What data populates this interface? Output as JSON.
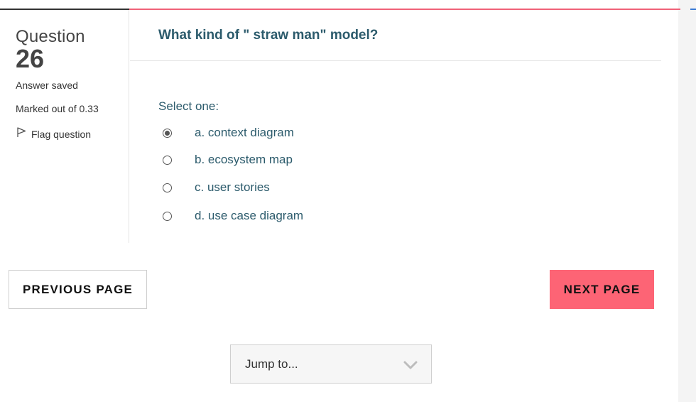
{
  "info": {
    "question_word": "Question",
    "question_number": "26",
    "state": "Answer saved",
    "grade": "Marked out of 0.33",
    "flag_label": "Flag question",
    "flag_icon": "flag-icon"
  },
  "question": {
    "text": "What kind of \" straw man\" model?",
    "prompt": "Select one:",
    "options": [
      {
        "label": "a. context diagram",
        "selected": true
      },
      {
        "label": "b. ecosystem map",
        "selected": false
      },
      {
        "label": "c. user stories",
        "selected": false
      },
      {
        "label": "d. use case diagram",
        "selected": false
      }
    ]
  },
  "navigation": {
    "previous_label": "PREVIOUS PAGE",
    "next_label": "NEXT PAGE",
    "jump_placeholder": "Jump to...",
    "jump_icon": "chevron-down-icon"
  },
  "colors": {
    "accent": "#f06278",
    "next_button": "#fd6475",
    "question_text": "#2c5b6c"
  }
}
